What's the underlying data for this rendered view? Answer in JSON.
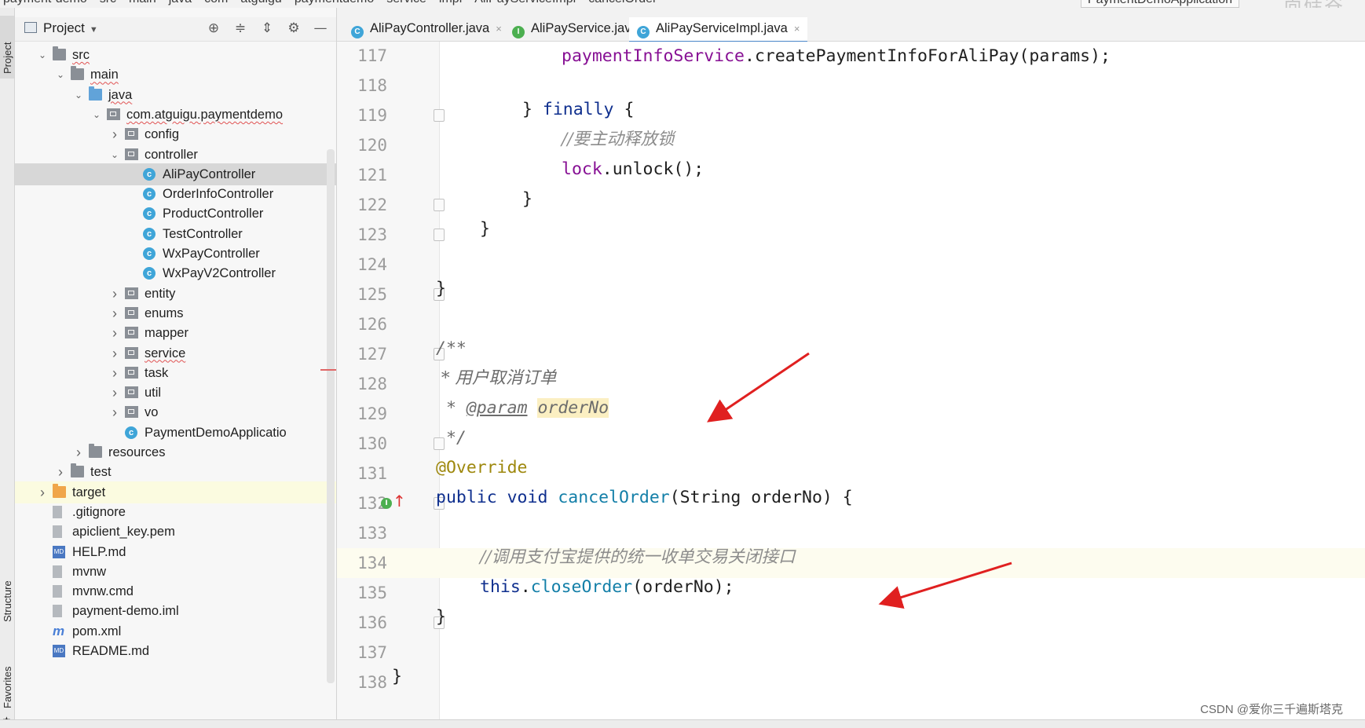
{
  "breadcrumb": [
    "payment-demo",
    "src",
    "main",
    "java",
    "com",
    "atguigu",
    "paymentdemo",
    "service",
    "impl",
    "AliPayServiceImpl",
    "cancelOrder"
  ],
  "run_config": "PaymentDemoApplication",
  "watermark_top": "尚硅谷",
  "toolwindows": {
    "project": "Project",
    "structure": "Structure",
    "favorites": "Favorites"
  },
  "project_panel": {
    "title": "Project",
    "tree": [
      {
        "label": "src",
        "depth": 0,
        "arrow": "down",
        "icon": "folder"
      },
      {
        "label": "main",
        "depth": 1,
        "arrow": "down",
        "icon": "folder"
      },
      {
        "label": "java",
        "depth": 2,
        "arrow": "down",
        "icon": "folder-blue"
      },
      {
        "label": "com.atguigu.paymentdemo",
        "depth": 3,
        "arrow": "down",
        "icon": "package"
      },
      {
        "label": "config",
        "depth": 4,
        "arrow": "right",
        "icon": "package"
      },
      {
        "label": "controller",
        "depth": 4,
        "arrow": "down",
        "icon": "package"
      },
      {
        "label": "AliPayController",
        "depth": 5,
        "arrow": "",
        "icon": "class",
        "selected": true
      },
      {
        "label": "OrderInfoController",
        "depth": 5,
        "arrow": "",
        "icon": "class"
      },
      {
        "label": "ProductController",
        "depth": 5,
        "arrow": "",
        "icon": "class"
      },
      {
        "label": "TestController",
        "depth": 5,
        "arrow": "",
        "icon": "class"
      },
      {
        "label": "WxPayController",
        "depth": 5,
        "arrow": "",
        "icon": "class"
      },
      {
        "label": "WxPayV2Controller",
        "depth": 5,
        "arrow": "",
        "icon": "class"
      },
      {
        "label": "entity",
        "depth": 4,
        "arrow": "right",
        "icon": "package"
      },
      {
        "label": "enums",
        "depth": 4,
        "arrow": "right",
        "icon": "package"
      },
      {
        "label": "mapper",
        "depth": 4,
        "arrow": "right",
        "icon": "package"
      },
      {
        "label": "service",
        "depth": 4,
        "arrow": "right",
        "icon": "package"
      },
      {
        "label": "task",
        "depth": 4,
        "arrow": "right",
        "icon": "package"
      },
      {
        "label": "util",
        "depth": 4,
        "arrow": "right",
        "icon": "package"
      },
      {
        "label": "vo",
        "depth": 4,
        "arrow": "right",
        "icon": "package"
      },
      {
        "label": "PaymentDemoApplicatio",
        "depth": 4,
        "arrow": "",
        "icon": "class"
      },
      {
        "label": "resources",
        "depth": 2,
        "arrow": "right",
        "icon": "folder"
      },
      {
        "label": "test",
        "depth": 1,
        "arrow": "right",
        "icon": "folder"
      },
      {
        "label": "target",
        "depth": 0,
        "arrow": "right",
        "icon": "folder-orange",
        "highlight": true
      },
      {
        "label": ".gitignore",
        "depth": 0,
        "arrow": "",
        "icon": "file"
      },
      {
        "label": "apiclient_key.pem",
        "depth": 0,
        "arrow": "",
        "icon": "file"
      },
      {
        "label": "HELP.md",
        "depth": 0,
        "arrow": "",
        "icon": "md"
      },
      {
        "label": "mvnw",
        "depth": 0,
        "arrow": "",
        "icon": "file"
      },
      {
        "label": "mvnw.cmd",
        "depth": 0,
        "arrow": "",
        "icon": "file"
      },
      {
        "label": "payment-demo.iml",
        "depth": 0,
        "arrow": "",
        "icon": "file"
      },
      {
        "label": "pom.xml",
        "depth": 0,
        "arrow": "",
        "icon": "maven"
      },
      {
        "label": "README.md",
        "depth": 0,
        "arrow": "",
        "icon": "md"
      }
    ]
  },
  "tabs": [
    {
      "label": "AliPayController.java",
      "icon": "C",
      "color": "#3fa5d8",
      "active": false
    },
    {
      "label": "AliPayService.java",
      "icon": "I",
      "color": "#4caf50",
      "active": false
    },
    {
      "label": "AliPayServiceImpl.java",
      "icon": "C",
      "color": "#3fa5d8",
      "active": true
    }
  ],
  "code": {
    "current_line": 134,
    "lines": [
      {
        "n": "117",
        "fold": false
      },
      {
        "n": "118",
        "fold": false
      },
      {
        "n": "119",
        "fold": true
      },
      {
        "n": "120",
        "fold": false
      },
      {
        "n": "121",
        "fold": false
      },
      {
        "n": "122",
        "fold": true
      },
      {
        "n": "123",
        "fold": true
      },
      {
        "n": "124",
        "fold": false
      },
      {
        "n": "125",
        "fold": true
      },
      {
        "n": "126",
        "fold": false
      },
      {
        "n": "127",
        "fold": true
      },
      {
        "n": "128",
        "fold": false
      },
      {
        "n": "129",
        "fold": false
      },
      {
        "n": "130",
        "fold": true
      },
      {
        "n": "131",
        "fold": false
      },
      {
        "n": "132",
        "fold": true
      },
      {
        "n": "133",
        "fold": false
      },
      {
        "n": "134",
        "fold": false
      },
      {
        "n": "135",
        "fold": false
      },
      {
        "n": "136",
        "fold": true
      },
      {
        "n": "137",
        "fold": false
      },
      {
        "n": "138",
        "fold": false
      }
    ],
    "text": {
      "l117_field": "paymentInfoService",
      "l117_rest": ".createPaymentInfoForAliPay(params);",
      "l119_brace": "} ",
      "l119_kw": "finally",
      "l119_rest": " {",
      "l120": "//要主动释放锁",
      "l121_field": "lock",
      "l121_rest": ".unlock();",
      "l122": "}",
      "l123": "}",
      "l125": "}",
      "l127": "/**",
      "l128": " * 用户取消订单",
      "l129_star": " * ",
      "l129_tag": "@param",
      "l129_param": "orderNo",
      "l130": " */",
      "l131": "@Override",
      "l132_kw": "public void ",
      "l132_fn": "cancelOrder",
      "l132_rest": "(String orderNo) {",
      "l134": "//调用支付宝提供的统一收单交易关闭接口",
      "l135_kw": "this",
      "l135_dot": ".",
      "l135_fn": "closeOrder",
      "l135_rest": "(orderNo);",
      "l136": "}",
      "l138": "}"
    }
  },
  "watermark_bottom": "CSDN @爱你三千遍斯塔克",
  "colors": {
    "keyword": "#0f2f8e",
    "method": "#137fa8",
    "field": "#871094",
    "comment": "#8c8c8c",
    "annotation": "#9e880d",
    "annotation_arrow": "#e02020"
  }
}
